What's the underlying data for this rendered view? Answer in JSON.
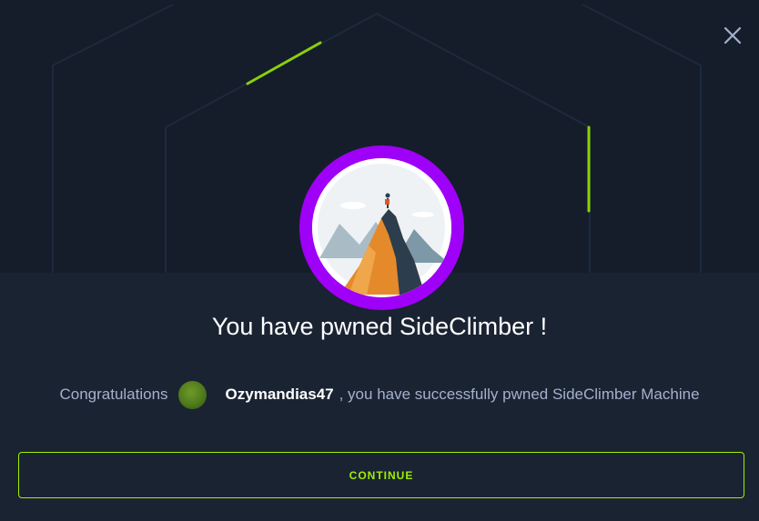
{
  "dialog": {
    "title": "You have pwned SideClimber !",
    "message_prefix": "Congratulations",
    "username": "Ozymandias47",
    "message_suffix": ", you have successfully pwned SideClimber Machine",
    "continue_label": "CONTINUE",
    "machine_icon": "mountain-climber-avatar",
    "close_icon": "close-icon"
  },
  "colors": {
    "accent_green": "#9fef00",
    "avatar_ring": "#9f00f7",
    "background": "#1a2332",
    "text_muted": "#a4b1cd"
  }
}
